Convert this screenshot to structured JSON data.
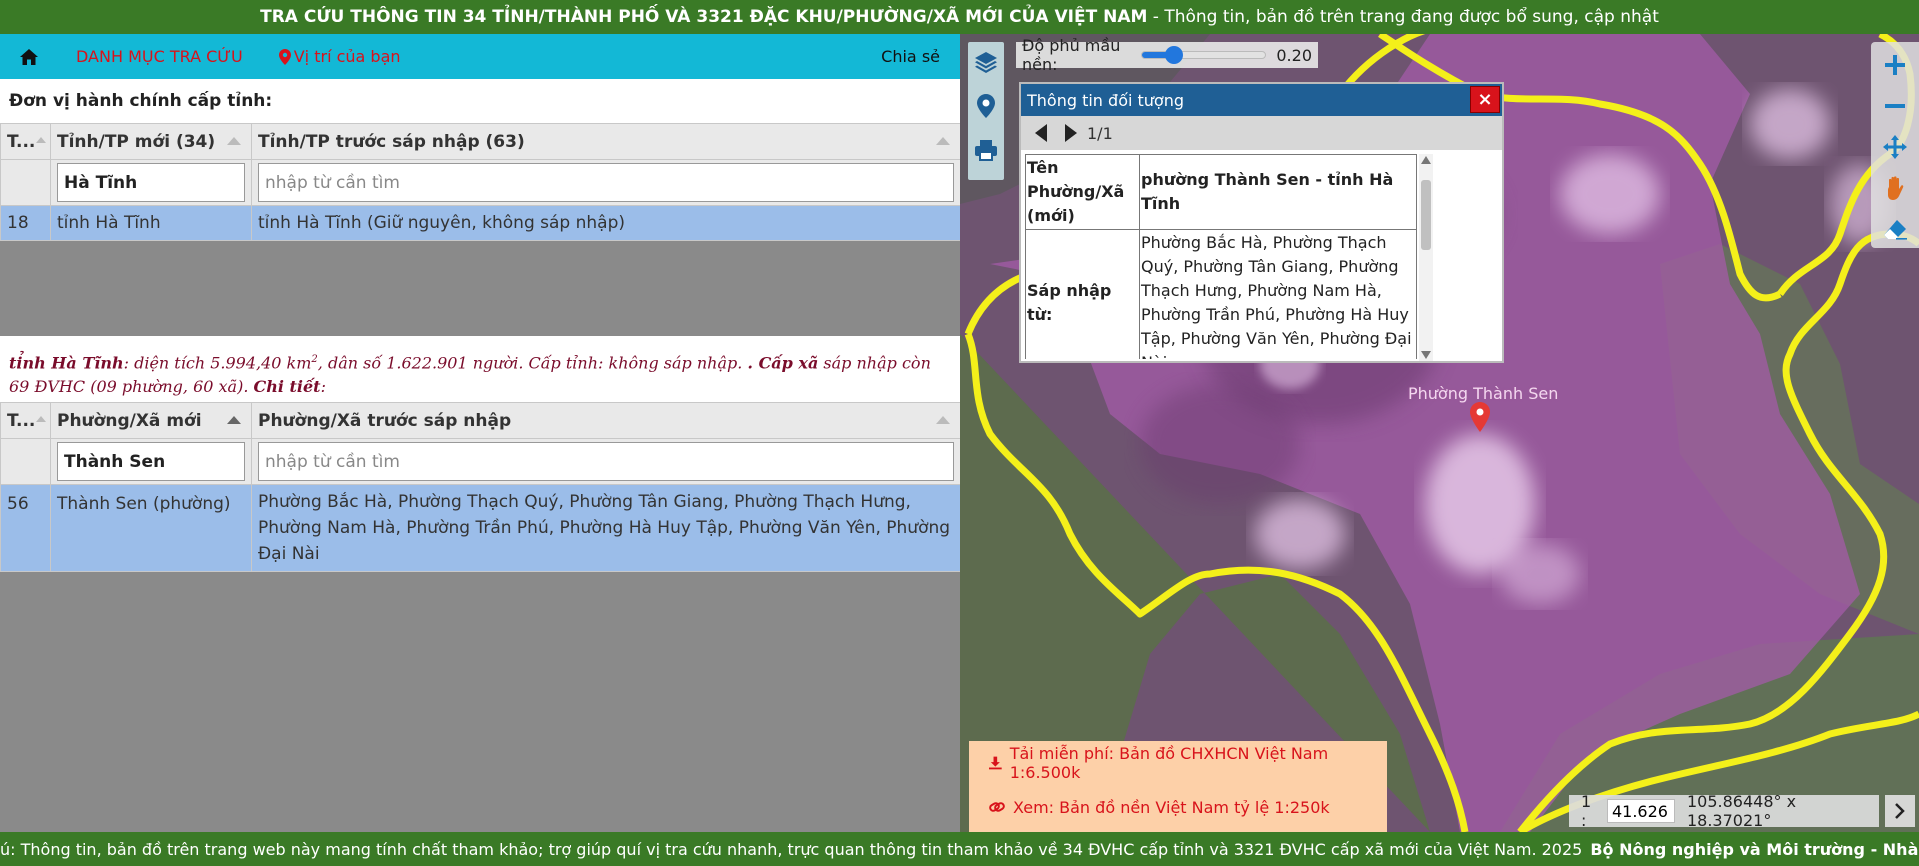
{
  "header": {
    "title_bold": "TRA CỨU THÔNG TIN 34 TỈNH/THÀNH PHỐ VÀ 3321 ĐẶC KHU/PHƯỜNG/XÃ MỚI CỦA VIỆT NAM",
    "title_rest": " - Thông tin, bản đồ trên trang đang được bổ sung, cập nhật"
  },
  "nav": {
    "catalog": "DANH MỤC TRA CỨU",
    "location": "Vị trí của bạn",
    "share": "Chia sẻ"
  },
  "province_section": {
    "heading": "Đơn vị hành chính cấp tỉnh:",
    "columns": [
      "T...",
      "Tỉnh/TP mới (34)",
      "Tỉnh/TP trước sáp nhập (63)"
    ],
    "filter_value": "Hà Tĩnh",
    "filter_placeholder": "nhập từ cần tìm",
    "rows": [
      {
        "stt": "18",
        "new": "tỉnh Hà Tĩnh",
        "old": "tỉnh Hà Tĩnh (Giữ nguyên, không sáp nhập)"
      }
    ]
  },
  "province_info": {
    "name": "tỉnh Hà Tĩnh",
    "area_text": ": diện tích 5.994,40 km",
    "sup": "2",
    "rest": ", dân số 1.622.901 người. Cấp tỉnh: không sáp nhập. ",
    "dot": ". ",
    "level_label": "Cấp xã",
    "level_text": " sáp nhập còn 69 ĐVHC (09 phường, 60 xã). ",
    "detail_label": "Chi tiết",
    "detail_colon": ":"
  },
  "ward_section": {
    "columns": [
      "T...",
      "Phường/Xã mới",
      "Phường/Xã trước sáp nhập"
    ],
    "filter_value": "Thành Sen",
    "filter_placeholder": "nhập từ cần tìm",
    "rows": [
      {
        "stt": "56",
        "new": "Thành Sen (phường)",
        "old": "Phường Bắc Hà, Phường Thạch Quý, Phường Tân Giang, Phường Thạch Hưng, Phường Nam Hà, Phường Trần Phú, Phường Hà Huy Tập, Phường Văn Yên, Phường Đại Nài"
      }
    ]
  },
  "map": {
    "opacity_label": "Độ phủ mầu nền:",
    "opacity_value": "0.20",
    "opacity_fraction": 0.2,
    "popup": {
      "title": "Thông tin đối tượng",
      "close": "×",
      "page": "1/1",
      "rows": [
        {
          "key": "Tên Phường/Xã (mới)",
          "value": "phường Thành Sen - tỉnh Hà Tĩnh"
        },
        {
          "key": "Sáp nhập từ:",
          "value": "Phường Bắc Hà, Phường Thạch Quý, Phường Tân Giang, Phường Thạch Hưng, Phường Nam Hà, Phường Trần Phú, Phường Hà Huy Tập, Phường Văn Yên, Phường Đại Nài"
        }
      ]
    },
    "place_label": "Phường Thành Sen",
    "download": "Tải miễn phí: Bản đồ CHXHCN Việt Nam 1:6.500k",
    "view": "Xem: Bản đồ nền Việt Nam tỷ lệ 1:250k",
    "scale_prefix": "1 :",
    "scale_value": "41.626",
    "coords": "105.86448° x 18.37021°",
    "colors": {
      "boundary": "#f4f01a",
      "overlay": "#b45cb4",
      "marker": "#e53935"
    }
  },
  "ticker": {
    "text": "ú: Thông tin, bản đồ trên trang web này mang tính chất tham khảo; trợ giúp quí vị tra cứu nhanh, trực quan thông tin tham khảo về 34 ĐVHC cấp tỉnh và 3321 ĐVHC cấp xã mới của Việt Nam. 2025",
    "bold": "Bộ Nông nghiệp và Môi trường - Nhà xuất bản Tài nguyên M"
  },
  "icons": [
    "home-icon",
    "map-pin-icon",
    "layers-icon",
    "location-icon",
    "print-icon",
    "zoom-in-icon",
    "zoom-out-icon",
    "pan-icon",
    "hand-icon",
    "eraser-icon",
    "download-icon",
    "link-icon",
    "chevron-right-icon"
  ]
}
